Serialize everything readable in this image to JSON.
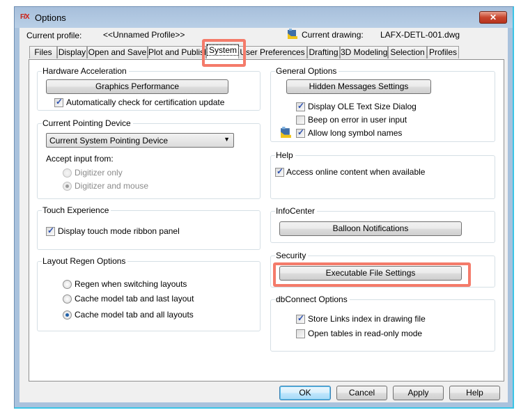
{
  "window": {
    "title": "Options",
    "app_icon": "F/X",
    "close_label": "✕"
  },
  "header": {
    "current_profile_label": "Current profile:",
    "current_profile_value": "<<Unnamed Profile>>",
    "current_drawing_label": "Current drawing:",
    "current_drawing_value": "LAFX-DETL-001.dwg"
  },
  "tabs": [
    {
      "label": "Files"
    },
    {
      "label": "Display"
    },
    {
      "label": "Open and Save"
    },
    {
      "label": "Plot and Publish"
    },
    {
      "label": "System",
      "active": true
    },
    {
      "label": "User Preferences"
    },
    {
      "label": "Drafting"
    },
    {
      "label": "3D Modeling"
    },
    {
      "label": "Selection"
    },
    {
      "label": "Profiles"
    }
  ],
  "hardware_acceleration": {
    "title": "Hardware Acceleration",
    "button": "Graphics Performance",
    "auto_check_label": "Automatically check for certification update",
    "auto_check": true
  },
  "pointing_device": {
    "title": "Current Pointing Device",
    "selected": "Current System Pointing Device",
    "accept_label": "Accept input from:",
    "options": [
      {
        "label": "Digitizer only",
        "selected": false
      },
      {
        "label": "Digitizer and mouse",
        "selected": true
      }
    ]
  },
  "touch_experience": {
    "title": "Touch Experience",
    "ribbon_label": "Display touch mode ribbon panel",
    "ribbon_checked": true
  },
  "layout_regen": {
    "title": "Layout Regen Options",
    "options": [
      {
        "label": "Regen when switching layouts",
        "selected": false
      },
      {
        "label": "Cache model tab and last layout",
        "selected": false
      },
      {
        "label": "Cache model tab and all layouts",
        "selected": true
      }
    ]
  },
  "general_options": {
    "title": "General Options",
    "button": "Hidden Messages Settings",
    "checks": [
      {
        "label": "Display OLE Text Size Dialog",
        "checked": true
      },
      {
        "label": "Beep on error in user input",
        "checked": false
      },
      {
        "label": "Allow long symbol names",
        "checked": true
      }
    ]
  },
  "help_group": {
    "title": "Help",
    "online_label": "Access online content when available",
    "online_checked": true
  },
  "infocenter": {
    "title": "InfoCenter",
    "button": "Balloon Notifications"
  },
  "security": {
    "title": "Security",
    "button": "Executable File Settings"
  },
  "dbconnect": {
    "title": "dbConnect Options",
    "checks": [
      {
        "label": "Store Links index in drawing file",
        "checked": true
      },
      {
        "label": "Open tables in read-only mode",
        "checked": false
      }
    ]
  },
  "footer": {
    "ok": "OK",
    "cancel": "Cancel",
    "apply": "Apply",
    "help": "Help"
  },
  "colors": {
    "highlight": "#f47b6a",
    "titlebar": "#a9c2dd"
  }
}
